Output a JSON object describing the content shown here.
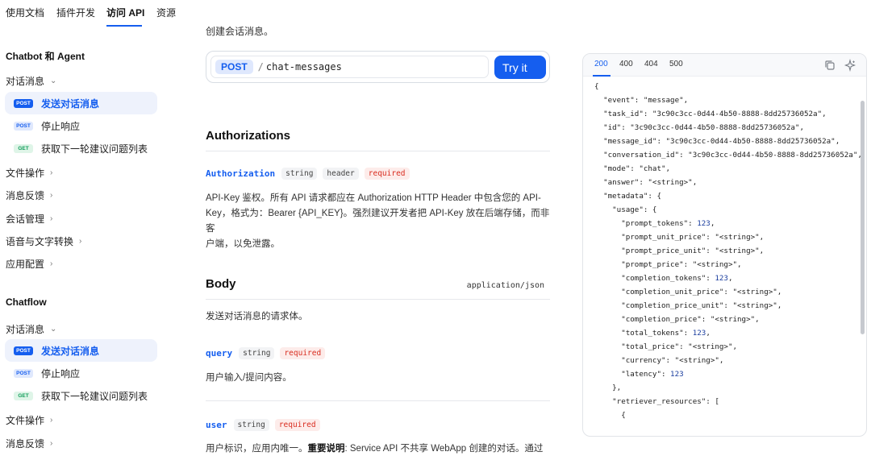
{
  "topnav": {
    "tabs": [
      "使用文档",
      "插件开发",
      "访问 API",
      "资源"
    ]
  },
  "sidebar": {
    "sections": [
      {
        "title": "Chatbot 和 Agent",
        "groups": [
          "对话消息",
          "文件操作",
          "消息反馈",
          "会话管理",
          "语音与文字转换",
          "应用配置"
        ],
        "items": [
          {
            "method": "POST",
            "label": "发送对话消息"
          },
          {
            "method": "POST",
            "label": "停止响应"
          },
          {
            "method": "GET",
            "label": "获取下一轮建议问题列表"
          }
        ]
      },
      {
        "title": "Chatflow",
        "groups": [
          "对话消息",
          "文件操作",
          "消息反馈"
        ],
        "items": [
          {
            "method": "POST",
            "label": "发送对话消息"
          },
          {
            "method": "POST",
            "label": "停止响应"
          },
          {
            "method": "GET",
            "label": "获取下一轮建议问题列表"
          }
        ]
      }
    ]
  },
  "main": {
    "cut_text": "创建会话消息。",
    "endpoint": {
      "method": "POST",
      "slash": "/",
      "path": "chat-messages",
      "try_label": "Try it"
    },
    "authorizations": {
      "title": "Authorizations",
      "param": {
        "name": "Authorization",
        "type": "string",
        "location": "header",
        "required": "required"
      },
      "desc_lines": [
        "API-Key 鉴权。所有 API 请求都应在 Authorization HTTP Header 中包含您的 API-",
        "Key，格式为：Bearer {API_KEY}。强烈建议开发者把 API-Key 放在后端存储，而非客",
        "户端，以免泄露。"
      ]
    },
    "body": {
      "title": "Body",
      "content_type": "application/json",
      "desc": "发送对话消息的请求体。",
      "params": [
        {
          "name": "query",
          "type": "string",
          "required": "required",
          "desc": "用户输入/提问内容。"
        },
        {
          "name": "user",
          "type": "string",
          "required": "required",
          "desc_prefix": "用户标识，应用内唯一。",
          "desc_bold": "重要说明",
          "desc_suffix": ": Service API 不共享 WebApp 创建的对话。通过"
        }
      ]
    }
  },
  "code": {
    "tabs": [
      "200",
      "400",
      "404",
      "500"
    ],
    "lines": [
      "{",
      "  \"event\": \"message\",",
      "  \"task_id\": \"3c90c3cc-0d44-4b50-8888-8dd25736052a\",",
      "  \"id\": \"3c90c3cc-0d44-4b50-8888-8dd25736052a\",",
      "  \"message_id\": \"3c90c3cc-0d44-4b50-8888-8dd25736052a\",",
      "  \"conversation_id\": \"3c90c3cc-0d44-4b50-8888-8dd25736052a\",",
      "  \"mode\": \"chat\",",
      "  \"answer\": \"<string>\",",
      "  \"metadata\": {",
      "    \"usage\": {",
      "      \"prompt_tokens\": 123,",
      "      \"prompt_unit_price\": \"<string>\",",
      "      \"prompt_price_unit\": \"<string>\",",
      "      \"prompt_price\": \"<string>\",",
      "      \"completion_tokens\": 123,",
      "      \"completion_unit_price\": \"<string>\",",
      "      \"completion_price_unit\": \"<string>\",",
      "      \"completion_price\": \"<string>\",",
      "      \"total_tokens\": 123,",
      "      \"total_price\": \"<string>\",",
      "      \"currency\": \"<string>\",",
      "      \"latency\": 123",
      "    },",
      "    \"retriever_resources\": [",
      "      {"
    ]
  }
}
